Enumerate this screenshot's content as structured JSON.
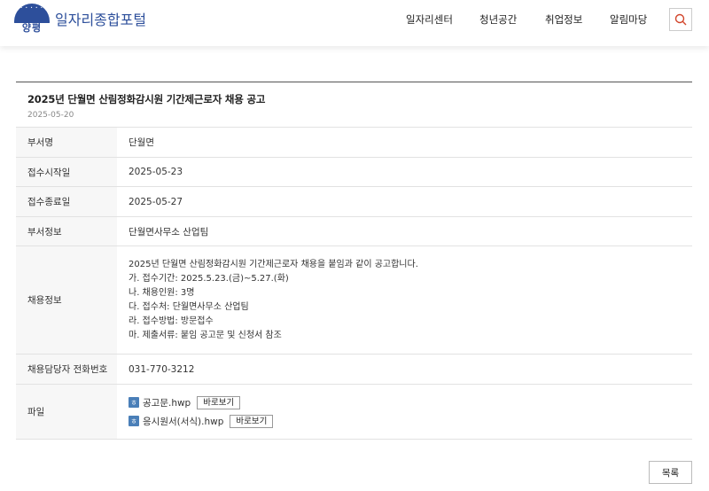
{
  "header": {
    "logo_text": "양평",
    "site_title": "일자리종합포털",
    "nav": [
      "일자리센터",
      "청년공간",
      "취업정보",
      "알림마당"
    ]
  },
  "post": {
    "title": "2025년 단월면 산림정화감시원 기간제근로자 채용 공고",
    "date": "2025-05-20"
  },
  "fields": {
    "dept_label": "부서명",
    "dept_value": "단월면",
    "start_label": "접수시작일",
    "start_value": "2025-05-23",
    "end_label": "접수종료일",
    "end_value": "2025-05-27",
    "deptinfo_label": "부서정보",
    "deptinfo_value": "단월면사무소 산업팀",
    "recruit_label": "채용정보",
    "recruit_lines": [
      "2025년 단월면 산림정화감시원 기간제근로자 채용을 붙임과 같이 공고합니다.",
      "가. 접수기간: 2025.5.23.(금)~5.27.(화)",
      "나. 채용인원: 3명",
      "다. 접수처: 단월면사무소 산업팀",
      "라. 접수방법: 방문접수",
      "마. 제출서류: 붙임 공고문 및 신청서 참조"
    ],
    "phone_label": "채용담당자 전화번호",
    "phone_value": "031-770-3212",
    "file_label": "파일",
    "files": [
      {
        "name": "공고문.hwp",
        "button": "바로보기"
      },
      {
        "name": "응시원서(서식).hwp",
        "button": "바로보기"
      }
    ]
  },
  "list_button": "목록",
  "icons": {
    "search": "search-icon",
    "file": "hwp-file-icon"
  },
  "colors": {
    "brand": "#2d4f9b",
    "file_icon": "#4a7fb8"
  }
}
